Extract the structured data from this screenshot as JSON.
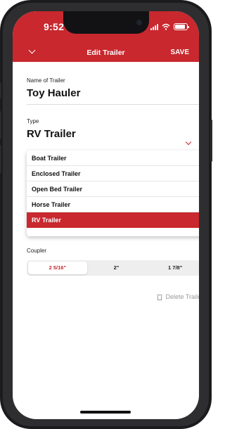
{
  "status_bar": {
    "time": "9:52"
  },
  "nav": {
    "title": "Edit Trailer",
    "save_label": "SAVE"
  },
  "name_field": {
    "label": "Name of Trailer",
    "value": "Toy Hauler"
  },
  "type_field": {
    "label": "Type",
    "value": "RV Trailer",
    "options": [
      "Boat Trailer",
      "Enclosed Trailer",
      "Open Bed Trailer",
      "Horse Trailer",
      "RV Trailer"
    ],
    "selected_index": 4
  },
  "coupler": {
    "label": "Coupler",
    "options": [
      "2 5/16\"",
      "2\"",
      "1 7/8\""
    ],
    "selected_index": 0
  },
  "delete_label": "Delete Trailer",
  "colors": {
    "accent": "#c8282e",
    "muted": "#9a9a9a"
  }
}
